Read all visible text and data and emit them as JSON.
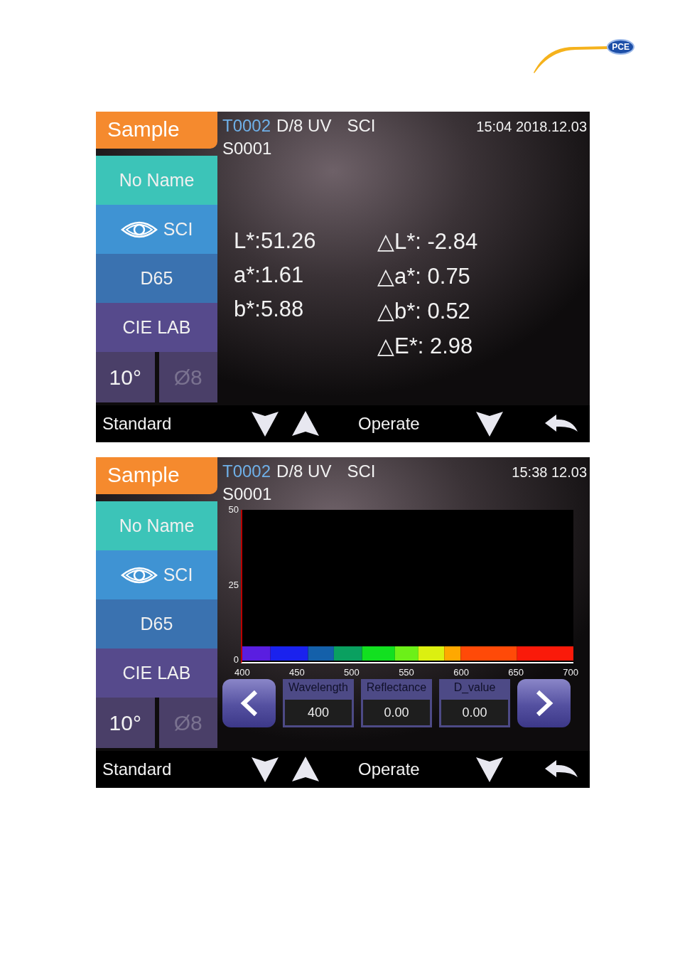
{
  "logo": {
    "badge": "PCE"
  },
  "screens": [
    {
      "kind": "values",
      "sidebar": {
        "mode_tab": "Sample",
        "items": [
          {
            "kind": "name",
            "label": "No Name"
          },
          {
            "kind": "sci",
            "label": "SCI"
          },
          {
            "kind": "illuminant",
            "label": "D65"
          },
          {
            "kind": "space",
            "label": "CIE LAB"
          }
        ],
        "observer": "10°",
        "aperture": {
          "label": "Ø8",
          "disabled": true
        }
      },
      "header": {
        "test_id": "T0002",
        "geometry": "D/8 UV",
        "mode": "SCI",
        "datetime": "15:04 2018.12.03",
        "sample_id": "S0001"
      },
      "values": [
        "L*:51.26",
        "a*:1.61",
        "b*:5.88"
      ],
      "deltas": [
        "△L*: -2.84",
        "△a*: 0.75",
        "△b*: 0.52",
        "△E*: 2.98"
      ],
      "bottom_bar": {
        "label": "Standard",
        "action": "Operate"
      }
    },
    {
      "kind": "spectrum",
      "sidebar": {
        "mode_tab": "Sample",
        "items": [
          {
            "kind": "name",
            "label": "No Name"
          },
          {
            "kind": "sci",
            "label": "SCI"
          },
          {
            "kind": "illuminant",
            "label": "D65"
          },
          {
            "kind": "space",
            "label": "CIE LAB"
          }
        ],
        "observer": "10°",
        "aperture": {
          "label": "Ø8",
          "disabled": true
        }
      },
      "header": {
        "test_id": "T0002",
        "geometry": "D/8 UV",
        "mode": "SCI",
        "datetime": "15:38  12.03",
        "sample_id": "S0001"
      },
      "chart": {
        "y_ticks": [
          "50",
          "25",
          "0"
        ],
        "x_ticks": [
          "400",
          "450",
          "500",
          "550",
          "600",
          "650",
          "700"
        ]
      },
      "readouts": [
        {
          "label": "Wavelength",
          "value": "400"
        },
        {
          "label": "Reflectance",
          "value": "0.00"
        },
        {
          "label": "D_value",
          "value": "0.00"
        }
      ],
      "bottom_bar": {
        "label": "Standard",
        "action": "Operate"
      }
    }
  ]
}
